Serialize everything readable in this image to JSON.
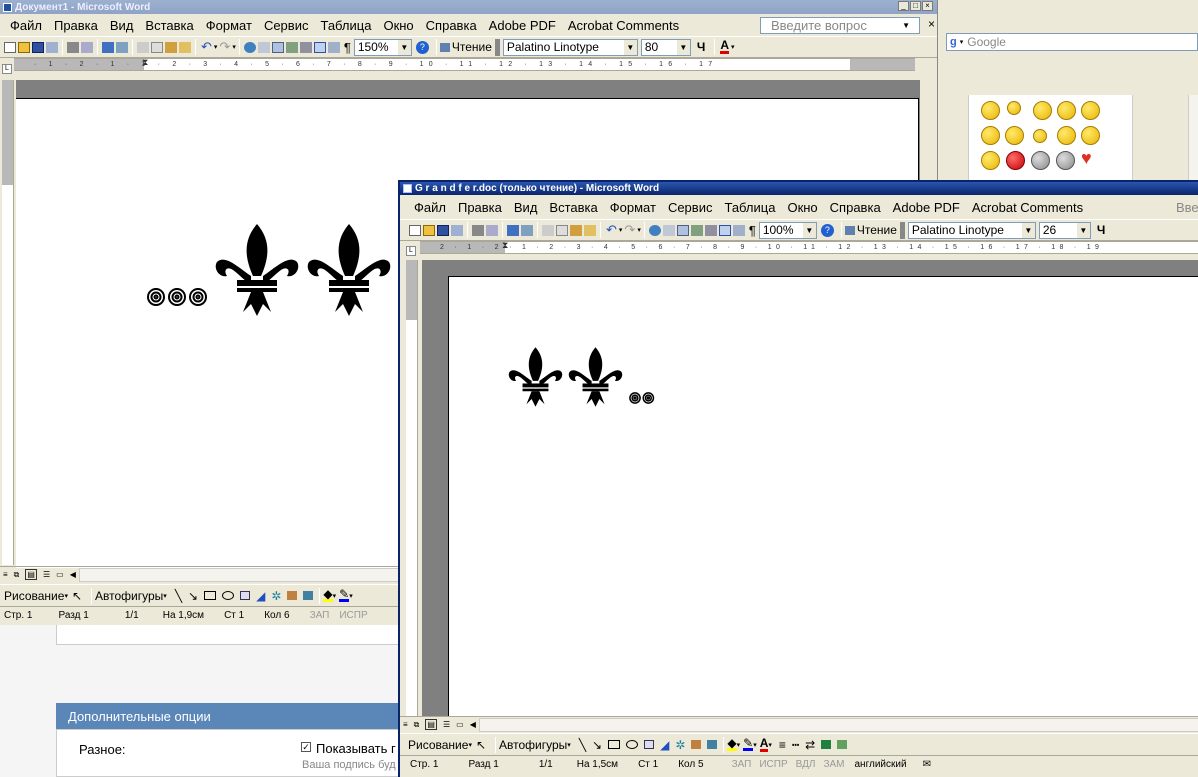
{
  "doc1": {
    "title": "Документ1 - Microsoft Word",
    "menu": [
      "Файл",
      "Правка",
      "Вид",
      "Вставка",
      "Формат",
      "Сервис",
      "Таблица",
      "Окно",
      "Справка",
      "Adobe PDF",
      "Acrobat Comments"
    ],
    "help_placeholder": "Введите вопрос",
    "zoom": "150%",
    "reading_label": "Чтение",
    "font_name": "Palatino Linotype",
    "font_size": "80",
    "ruler_numbers": "· 1 · 2 · 1 · 1 · 2 · 3 · 4 · 5 · 6 · 7 · 8 · 9 · 10 · 11 · 12 · 13 · 14 · 15 · 16 · 17",
    "draw_label": "Рисование",
    "autoshapes_label": "Автофигуры",
    "status": {
      "page": "Стр. 1",
      "section": "Разд 1",
      "pages": "1/1",
      "at": "На 1,9см",
      "line": "Ст 1",
      "col": "Кол 6",
      "rec": "ЗАП",
      "trk": "ИСПР"
    }
  },
  "doc2": {
    "title": "G r a n d f e r.doc (только чтение) - Microsoft Word",
    "menu": [
      "Файл",
      "Правка",
      "Вид",
      "Вставка",
      "Формат",
      "Сервис",
      "Таблица",
      "Окно",
      "Справка",
      "Adobe PDF",
      "Acrobat Comments"
    ],
    "help_placeholder": "Введ",
    "zoom": "100%",
    "reading_label": "Чтение",
    "font_name": "Palatino Linotype",
    "font_size": "26",
    "bold_label": "Ч",
    "ruler_numbers": "2 · 1 · 2 · 1 · 2 · 3 · 4 · 5 · 6 · 7 · 8 · 9 · 10 · 11 · 12 · 13 · 14 · 15 · 16 · 17 · 18 · 19",
    "draw_label": "Рисование",
    "autoshapes_label": "Автофигуры",
    "status": {
      "page": "Стр. 1",
      "section": "Разд 1",
      "pages": "1/1",
      "at": "На 1,5см",
      "line": "Ст 1",
      "col": "Кол 5",
      "rec": "ЗАП",
      "trk": "ИСПР",
      "ext": "ВДЛ",
      "ovr": "ЗАМ",
      "lang": "английский"
    }
  },
  "browser": {
    "search_placeholder": "Google"
  },
  "webform": {
    "section_title": "Дополнительные опции",
    "misc_label": "Разное:",
    "checkbox_label": "Показывать г",
    "hint": "Ваша подпись буд"
  },
  "colors": {
    "title_active": "#0a246a",
    "title_inactive": "#9db0cf",
    "chrome": "#ece9d8",
    "section_header": "#5a86b8"
  }
}
